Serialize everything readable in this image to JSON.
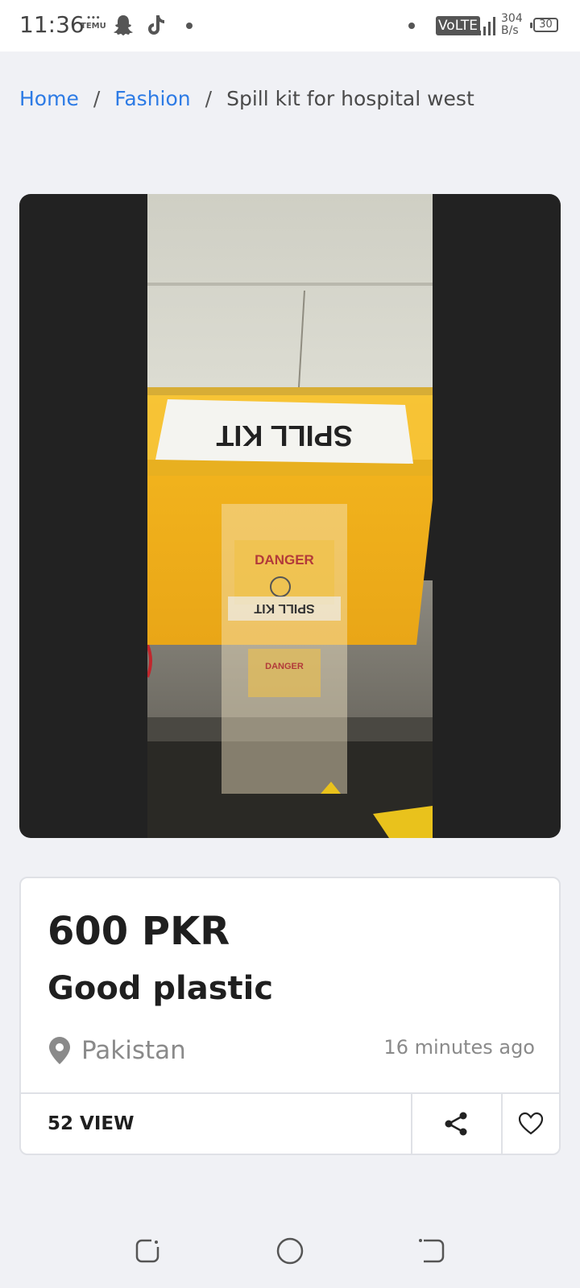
{
  "status_bar": {
    "time": "11:36",
    "temu_label": "TEMU",
    "network": "VoLTE",
    "speed_value": "304",
    "speed_unit": "B/s",
    "battery": "30",
    "icons": [
      "snapchat-icon",
      "tiktok-icon",
      "signal-icon",
      "battery-icon"
    ]
  },
  "breadcrumb": {
    "home": "Home",
    "separator": "/",
    "category": "Fashion",
    "current": "Spill kit for hospital west"
  },
  "media": {
    "photo_icon": "product-photo",
    "label_spill": "SPILL KIT",
    "label_danger": "DANGER"
  },
  "listing": {
    "price": "600 PKR",
    "title": "Good plastic",
    "location": "Pakistan",
    "posted": "16 minutes ago",
    "views": "52 VIEW"
  },
  "colors": {
    "link": "#2d7be5",
    "background": "#f0f1f5",
    "media_bg": "#222222",
    "box_yellow": "#f2b51c"
  }
}
